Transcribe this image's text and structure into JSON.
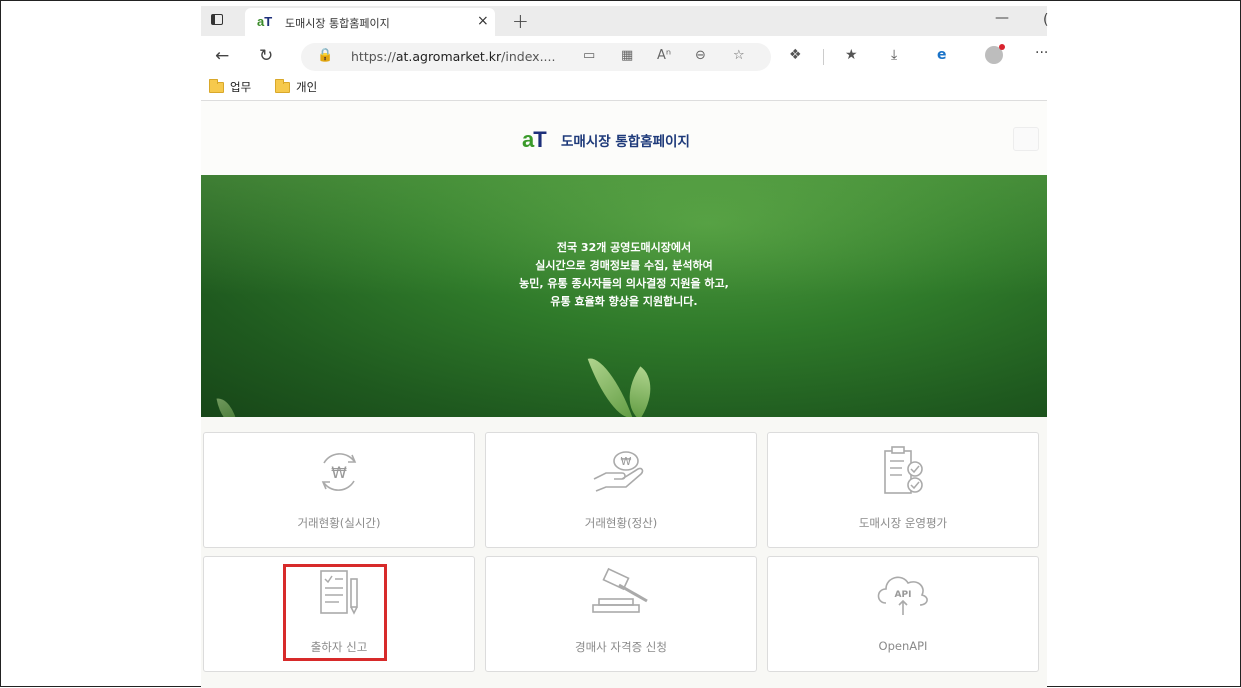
{
  "browser": {
    "tab": {
      "favicon_text_a": "a",
      "favicon_text_t": "T",
      "title": "도매시장 통합홈페이지",
      "close": "×"
    },
    "new_tab": "+",
    "minimize": "—",
    "maximize": "(",
    "url": {
      "prefix": "https://",
      "domain": "at.agromarket.kr",
      "path": "/index...."
    },
    "icons": [
      "back-icon",
      "refresh-icon",
      "lock-icon",
      "tablet-icon",
      "grid-icon",
      "read-aloud-icon",
      "zoom-icon",
      "add-favorite-icon",
      "extensions-icon",
      "favorites-icon",
      "downloads-icon",
      "ie-mode-icon",
      "profile-icon",
      "more-icon"
    ]
  },
  "bookmarks": [
    {
      "label": "업무"
    },
    {
      "label": "개인"
    }
  ],
  "header": {
    "logo_a": "a",
    "logo_t": "T",
    "title": "도매시장 통합홈페이지"
  },
  "hero": {
    "lines": [
      "전국 32개 공영도매시장에서",
      "실시간으로 경매정보를 수집, 분석하여",
      "농민, 유통 종사자들의 의사결정 지원을 하고,",
      "유통 효율화 향상을 지원합니다."
    ]
  },
  "menu": [
    {
      "label": "거래현황(실시간)",
      "icon": "won-cycle-icon"
    },
    {
      "label": "거래현황(정산)",
      "icon": "hand-coin-icon"
    },
    {
      "label": "도매시장 운영평가",
      "icon": "clipboard-check-icon"
    },
    {
      "label": "출하자 신고",
      "icon": "document-pen-icon"
    },
    {
      "label": "경매사 자격증 신청",
      "icon": "gavel-icon"
    },
    {
      "label": "OpenAPI",
      "icon": "cloud-api-icon"
    }
  ],
  "colors": {
    "highlight": "#d72a2a",
    "logo_green": "#3a9a2a",
    "logo_navy": "#1d2f7a",
    "hero_green": "#2f7a2a"
  }
}
